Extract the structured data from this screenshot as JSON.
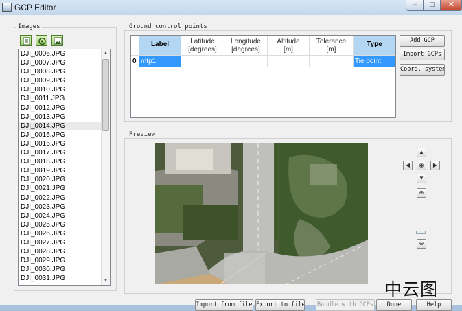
{
  "window": {
    "title": "GCP Editor"
  },
  "images": {
    "label": "Images",
    "buttons": [
      "add-image-icon",
      "gps-icon",
      "image-view-icon"
    ],
    "files": [
      "DJI_0006.JPG",
      "DJI_0007.JPG",
      "DJI_0008.JPG",
      "DJI_0009.JPG",
      "DJI_0010.JPG",
      "DJI_0011.JPG",
      "DJI_0012.JPG",
      "DJI_0013.JPG",
      "DJI_0014.JPG",
      "DJI_0015.JPG",
      "DJI_0016.JPG",
      "DJI_0017.JPG",
      "DJI_0018.JPG",
      "DJI_0019.JPG",
      "DJI_0020.JPG",
      "DJI_0021.JPG",
      "DJI_0022.JPG",
      "DJI_0023.JPG",
      "DJI_0024.JPG",
      "DJI_0025.JPG",
      "DJI_0026.JPG",
      "DJI_0027.JPG",
      "DJI_0028.JPG",
      "DJI_0029.JPG",
      "DJI_0030.JPG",
      "DJI_0031.JPG"
    ],
    "selected": "DJI_0014.JPG"
  },
  "gcp": {
    "label": "Ground control points",
    "columns": [
      "Label",
      "Latitude\n[degrees]",
      "Longitude\n[degrees]",
      "Altitude\n[m]",
      "Tolerance\n[m]",
      "Type"
    ],
    "rows": [
      {
        "index": "0",
        "label": "mtp1",
        "latitude": "",
        "longitude": "",
        "altitude": "",
        "tolerance": "",
        "type": "Tie point"
      }
    ],
    "buttons": {
      "add": "Add GCP",
      "import": "Import GCPs",
      "coord": "Coord. system"
    }
  },
  "preview": {
    "label": "Preview"
  },
  "footer": {
    "import_from_file": "Import from file",
    "export_to_file": "Export to file",
    "bundle": "Bundle with GCPs",
    "done": "Done",
    "help": "Help"
  },
  "watermark": "中云图",
  "colors": {
    "selection": "#3399ff",
    "header_selected": "#b3d7f3",
    "image_button": "#9ed070"
  }
}
